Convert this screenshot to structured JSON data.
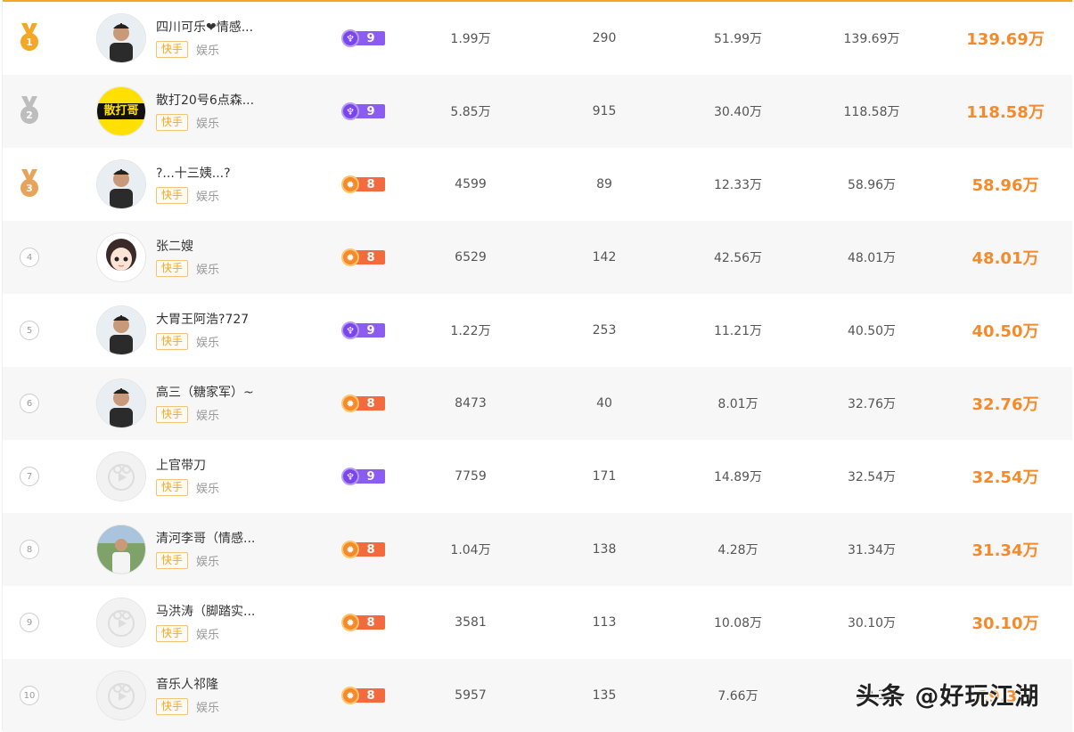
{
  "colors": {
    "accent": "#f58a2a",
    "gold": "#f5a623",
    "silver": "#bdbdbd",
    "bronze": "#e8a35a",
    "purple": "#8a5cf0",
    "orange": "#f26a3d"
  },
  "rows": [
    {
      "rank": "1",
      "name": "四川可乐❤情感...",
      "platform": "快手",
      "category": "娱乐",
      "level": "9",
      "level_type": "purple",
      "v1": "1.99万",
      "v2": "290",
      "v3": "51.99万",
      "v4": "139.69万",
      "total": "139.69万",
      "avatar": "person-photo"
    },
    {
      "rank": "2",
      "name": "散打20号6点森...",
      "platform": "快手",
      "category": "娱乐",
      "level": "9",
      "level_type": "purple",
      "v1": "5.85万",
      "v2": "915",
      "v3": "30.40万",
      "v4": "118.58万",
      "total": "118.58万",
      "avatar": "sandage-logo",
      "avatar_text": "散打哥"
    },
    {
      "rank": "3",
      "name": "?...十三姨...?",
      "platform": "快手",
      "category": "娱乐",
      "level": "8",
      "level_type": "orange",
      "v1": "4599",
      "v2": "89",
      "v3": "12.33万",
      "v4": "58.96万",
      "total": "58.96万",
      "avatar": "person-photo"
    },
    {
      "rank": "4",
      "name": "张二嫂",
      "platform": "快手",
      "category": "娱乐",
      "level": "8",
      "level_type": "orange",
      "v1": "6529",
      "v2": "142",
      "v3": "42.56万",
      "v4": "48.01万",
      "total": "48.01万",
      "avatar": "cartoon-girl"
    },
    {
      "rank": "5",
      "name": "大胃王阿浩?727",
      "platform": "快手",
      "category": "娱乐",
      "level": "9",
      "level_type": "purple",
      "v1": "1.22万",
      "v2": "253",
      "v3": "11.21万",
      "v4": "40.50万",
      "total": "40.50万",
      "avatar": "person-photo"
    },
    {
      "rank": "6",
      "name": "高三（糖家军）~",
      "platform": "快手",
      "category": "娱乐",
      "level": "8",
      "level_type": "orange",
      "v1": "8473",
      "v2": "40",
      "v3": "8.01万",
      "v4": "32.76万",
      "total": "32.76万",
      "avatar": "person-photo"
    },
    {
      "rank": "7",
      "name": "上官带刀",
      "platform": "快手",
      "category": "娱乐",
      "level": "9",
      "level_type": "purple",
      "v1": "7759",
      "v2": "171",
      "v3": "14.89万",
      "v4": "32.54万",
      "total": "32.54万",
      "avatar": "default-avatar"
    },
    {
      "rank": "8",
      "name": "清河李哥（情感...",
      "platform": "快手",
      "category": "娱乐",
      "level": "8",
      "level_type": "orange",
      "v1": "1.04万",
      "v2": "138",
      "v3": "4.28万",
      "v4": "31.34万",
      "total": "31.34万",
      "avatar": "person-outdoor"
    },
    {
      "rank": "9",
      "name": "马洪涛（脚踏实...",
      "platform": "快手",
      "category": "娱乐",
      "level": "8",
      "level_type": "orange",
      "v1": "3581",
      "v2": "113",
      "v3": "10.08万",
      "v4": "30.10万",
      "total": "30.10万",
      "avatar": "default-avatar"
    },
    {
      "rank": "10",
      "name": "音乐人祁隆",
      "platform": "快手",
      "category": "娱乐",
      "level": "8",
      "level_type": "orange",
      "v1": "5957",
      "v2": "135",
      "v3": "7.66万",
      "v4": "29.3",
      "total": "29.3万",
      "avatar": "default-avatar"
    }
  ],
  "watermark": "头条 @好玩江湖"
}
